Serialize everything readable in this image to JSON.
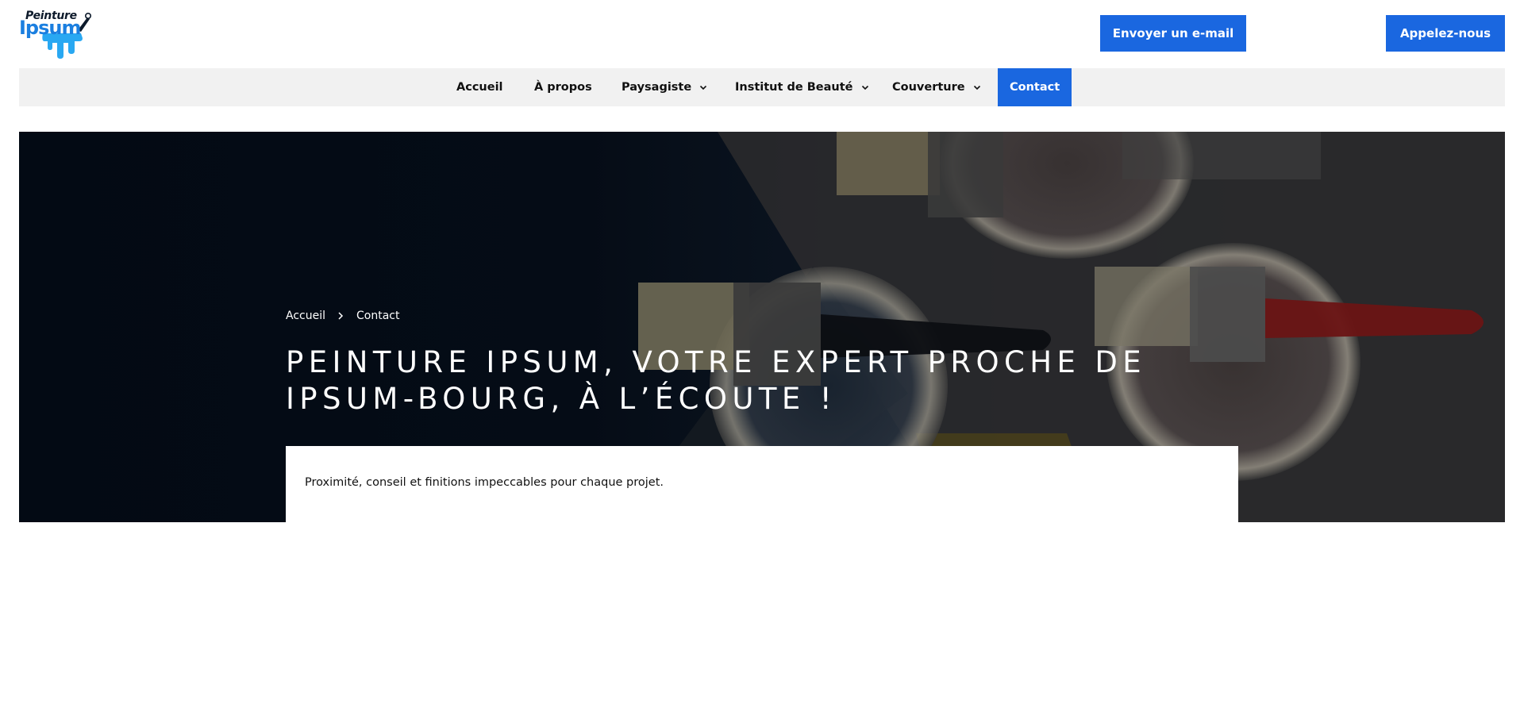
{
  "logo": {
    "line1": "Peinture",
    "line2": "Ipsum"
  },
  "header": {
    "email_button": "Envoyer un e-mail",
    "call_button": "Appelez-nous"
  },
  "nav": {
    "items": [
      {
        "label": "Accueil"
      },
      {
        "label": "À propos"
      },
      {
        "label": "Paysagiste",
        "has_dropdown": true
      },
      {
        "label": "Institut de Beauté",
        "has_dropdown": true
      },
      {
        "label": "Couverture",
        "has_dropdown": true
      },
      {
        "label": "Contact",
        "active": true
      }
    ]
  },
  "breadcrumb": {
    "home": "Accueil",
    "current": "Contact"
  },
  "hero": {
    "title": "PEINTURE IPSUM, VOTRE EXPERT PROCHE DE IPSUM-BOURG, À L’ÉCOUTE !",
    "intro": "Proximité, conseil et finitions impeccables pour chaque projet."
  },
  "colors": {
    "accent": "#1a67e0",
    "nav_bg": "#f1f1f1",
    "hero_dark": "#030a14"
  }
}
